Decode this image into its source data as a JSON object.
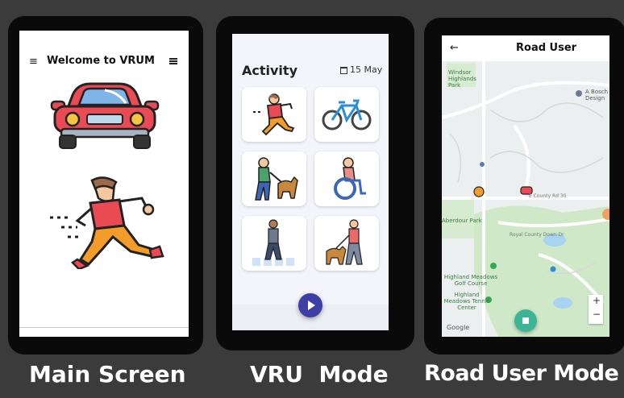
{
  "main_screen": {
    "header_title": "Welcome to VRUM",
    "caption": "Main Screen"
  },
  "vru_mode": {
    "title": "Activity",
    "date": "15 May",
    "tiles": [
      "running",
      "cycling",
      "assisted-walking",
      "wheelchair",
      "pedestrian-crossing",
      "dog-walking"
    ],
    "caption": "VRU  Mode"
  },
  "road_user_mode": {
    "title": "Road User",
    "map_labels": {
      "park1": "Windsor Highlands Park",
      "poi": "A Bosch Design",
      "street1": "E County Rd 30",
      "park2": "Aberdour Park",
      "golf": "Highland Meadows Golf Course",
      "tennis": "Highland Meadows Tennis Center",
      "street2": "Royal County Down Dr",
      "google": "Google"
    },
    "zoom_in": "+",
    "zoom_out": "−",
    "caption": "Road User Mode"
  },
  "colors": {
    "background": "#3b3b3b",
    "phone_frame": "#0a0a0a",
    "play_button": "#3d3fa6",
    "map_green": "#cfe8c8",
    "stop_button": "#3bb596"
  }
}
